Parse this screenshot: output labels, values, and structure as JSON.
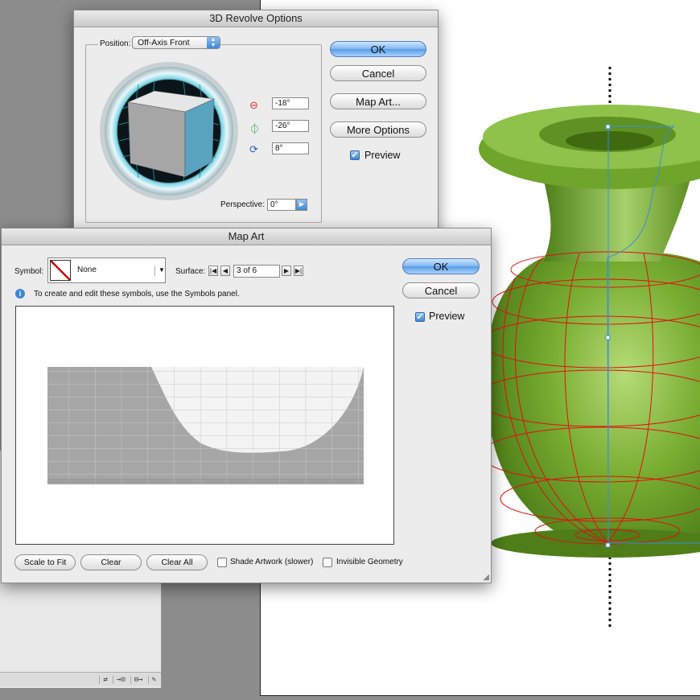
{
  "revolve_dialog": {
    "title": "3D Revolve Options",
    "position_label": "Position:",
    "position_value": "Off-Axis Front",
    "rot_x": "-18°",
    "rot_y": "-26°",
    "rot_z": "8°",
    "perspective_label": "Perspective:",
    "perspective_value": "0°",
    "ok": "OK",
    "cancel": "Cancel",
    "map_art": "Map Art...",
    "more_options": "More Options",
    "preview": "Preview"
  },
  "map_dialog": {
    "title": "Map Art",
    "symbol_label": "Symbol:",
    "symbol_value": "None",
    "surface_label": "Surface:",
    "surface_value": "3 of 6",
    "info_text": "To create and edit these symbols, use the Symbols panel.",
    "ok": "OK",
    "cancel": "Cancel",
    "preview": "Preview",
    "scale_to_fit": "Scale to Fit",
    "clear": "Clear",
    "clear_all": "Clear All",
    "shade_artwork": "Shade Artwork (slower)",
    "invisible_geometry": "Invisible Geometry"
  },
  "colors": {
    "vase_green": "#6fa12a",
    "wireframe_red": "#e01010",
    "selection_blue": "#3a8fd8",
    "cube_face": "#5aa3bf"
  }
}
